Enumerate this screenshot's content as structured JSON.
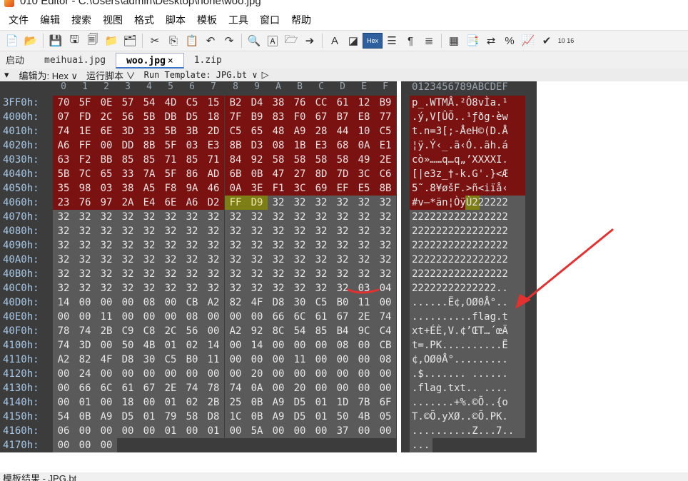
{
  "window": {
    "title": "010 Editor - C:\\Users\\admin\\Desktop\\none\\woo.jpg"
  },
  "menu": [
    "文件",
    "编辑",
    "搜索",
    "视图",
    "格式",
    "脚本",
    "模板",
    "工具",
    "窗口",
    "帮助"
  ],
  "toolbar": {
    "icons": [
      "new-file-icon",
      "open-folder-icon",
      "save-icon",
      "save-as-icon",
      "save-all-icon",
      "open-folder2-icon",
      "copy-files-icon",
      "cut-icon",
      "copy-icon",
      "paste-icon",
      "undo-icon",
      "redo-icon",
      "find-icon",
      "find-replace-icon",
      "find-in-files-icon",
      "goto-icon",
      "font-icon",
      "highlight-icon",
      "hex-mode-icon",
      "columns-icon",
      "paragraph-icon",
      "file-list-icon",
      "calculator-icon",
      "clipboard-icon",
      "swap-icon",
      "percent-icon",
      "chart-icon",
      "check-arrows-icon",
      "base-convert-icon"
    ],
    "hex_label": "Hex",
    "base_label": "10 16"
  },
  "tabs": [
    {
      "label": "启动"
    },
    {
      "label": "meihuai.jpg"
    },
    {
      "label": "woo.jpg",
      "close": "×"
    },
    {
      "label": "1.zip"
    }
  ],
  "options": {
    "collapse": "▾",
    "edit_as": "编辑为: Hex ∨",
    "run_script": "运行脚本 ∨",
    "run_template": "Run Template: JPG.bt ∨",
    "play": "▷"
  },
  "hex": {
    "columns": [
      "0",
      "1",
      "2",
      "3",
      "4",
      "5",
      "6",
      "7",
      "8",
      "9",
      "A",
      "B",
      "C",
      "D",
      "E",
      "F"
    ],
    "text_header": "0123456789ABCDEF",
    "rows": [
      {
        "addr": "3FF0h:",
        "bytes": [
          "70",
          "5F",
          "0E",
          "57",
          "54",
          "4D",
          "C5",
          "15",
          "B2",
          "D4",
          "38",
          "76",
          "CC",
          "61",
          "12",
          "B9"
        ],
        "text": "p_.WTMÅ.²Ô8vÌa.¹"
      },
      {
        "addr": "4000h:",
        "bytes": [
          "07",
          "FD",
          "2C",
          "56",
          "5B",
          "DB",
          "D5",
          "18",
          "7F",
          "B9",
          "83",
          "F0",
          "67",
          "B7",
          "E8",
          "77"
        ],
        "text": ".ý,V[ÛÕ..¹ƒðg·èw"
      },
      {
        "addr": "4010h:",
        "bytes": [
          "74",
          "1E",
          "6E",
          "3D",
          "33",
          "5B",
          "3B",
          "2D",
          "C5",
          "65",
          "48",
          "A9",
          "28",
          "44",
          "10",
          "C5"
        ],
        "text": "t.n=3[;-ÅeH©(D.Å"
      },
      {
        "addr": "4020h:",
        "bytes": [
          "A6",
          "FF",
          "00",
          "DD",
          "8B",
          "5F",
          "03",
          "E3",
          "8B",
          "D3",
          "08",
          "1B",
          "E3",
          "68",
          "0A",
          "E1"
        ],
        "text": "¦ÿ.Ý‹_.ã‹Ó..ãh.á"
      },
      {
        "addr": "4030h:",
        "bytes": [
          "63",
          "F2",
          "BB",
          "85",
          "85",
          "71",
          "85",
          "71",
          "84",
          "92",
          "58",
          "58",
          "58",
          "58",
          "49",
          "2E"
        ],
        "text": "cò»……q…q„’XXXXI."
      },
      {
        "addr": "4040h:",
        "bytes": [
          "5B",
          "7C",
          "65",
          "33",
          "7A",
          "5F",
          "86",
          "AD",
          "6B",
          "0B",
          "47",
          "27",
          "8D",
          "7D",
          "3C",
          "C6"
        ],
        "text": "[|e3z_†-k.G'.}<Æ"
      },
      {
        "addr": "4050h:",
        "bytes": [
          "35",
          "98",
          "03",
          "38",
          "A5",
          "F8",
          "9A",
          "46",
          "0A",
          "3E",
          "F1",
          "3C",
          "69",
          "EF",
          "E5",
          "8B"
        ],
        "text": "5˜.8¥øšF.>ñ<iïå‹"
      },
      {
        "addr": "4060h:",
        "bytes": [
          "23",
          "76",
          "97",
          "2A",
          "E4",
          "6E",
          "A6",
          "D2",
          "FF",
          "D9",
          "32",
          "32",
          "32",
          "32",
          "32",
          "32"
        ],
        "text": "#v—*än¦ÒÿÙ222222"
      },
      {
        "addr": "4070h:",
        "bytes": [
          "32",
          "32",
          "32",
          "32",
          "32",
          "32",
          "32",
          "32",
          "32",
          "32",
          "32",
          "32",
          "32",
          "32",
          "32",
          "32"
        ],
        "text": "2222222222222222"
      },
      {
        "addr": "4080h:",
        "bytes": [
          "32",
          "32",
          "32",
          "32",
          "32",
          "32",
          "32",
          "32",
          "32",
          "32",
          "32",
          "32",
          "32",
          "32",
          "32",
          "32"
        ],
        "text": "2222222222222222"
      },
      {
        "addr": "4090h:",
        "bytes": [
          "32",
          "32",
          "32",
          "32",
          "32",
          "32",
          "32",
          "32",
          "32",
          "32",
          "32",
          "32",
          "32",
          "32",
          "32",
          "32"
        ],
        "text": "2222222222222222"
      },
      {
        "addr": "40A0h:",
        "bytes": [
          "32",
          "32",
          "32",
          "32",
          "32",
          "32",
          "32",
          "32",
          "32",
          "32",
          "32",
          "32",
          "32",
          "32",
          "32",
          "32"
        ],
        "text": "2222222222222222"
      },
      {
        "addr": "40B0h:",
        "bytes": [
          "32",
          "32",
          "32",
          "32",
          "32",
          "32",
          "32",
          "32",
          "32",
          "32",
          "32",
          "32",
          "32",
          "32",
          "32",
          "32"
        ],
        "text": "2222222222222222"
      },
      {
        "addr": "40C0h:",
        "bytes": [
          "32",
          "32",
          "32",
          "32",
          "32",
          "32",
          "32",
          "32",
          "32",
          "32",
          "32",
          "32",
          "32",
          "32",
          "03",
          "04"
        ],
        "text": "22222222222222.."
      },
      {
        "addr": "40D0h:",
        "bytes": [
          "14",
          "00",
          "00",
          "00",
          "08",
          "00",
          "CB",
          "A2",
          "82",
          "4F",
          "D8",
          "30",
          "C5",
          "B0",
          "11",
          "00"
        ],
        "text": "......Ë¢‚OØ0Å°.."
      },
      {
        "addr": "40E0h:",
        "bytes": [
          "00",
          "00",
          "11",
          "00",
          "00",
          "00",
          "08",
          "00",
          "00",
          "00",
          "66",
          "6C",
          "61",
          "67",
          "2E",
          "74"
        ],
        "text": "..........flag.t"
      },
      {
        "addr": "40F0h:",
        "bytes": [
          "78",
          "74",
          "2B",
          "C9",
          "C8",
          "2C",
          "56",
          "00",
          "A2",
          "92",
          "8C",
          "54",
          "85",
          "B4",
          "9C",
          "C4"
        ],
        "text": "xt+ÉÈ,V.¢’ŒT…´œÄ"
      },
      {
        "addr": "4100h:",
        "bytes": [
          "74",
          "3D",
          "00",
          "50",
          "4B",
          "01",
          "02",
          "14",
          "00",
          "14",
          "00",
          "00",
          "00",
          "08",
          "00",
          "CB"
        ],
        "text": "t=.PK..........Ë"
      },
      {
        "addr": "4110h:",
        "bytes": [
          "A2",
          "82",
          "4F",
          "D8",
          "30",
          "C5",
          "B0",
          "11",
          "00",
          "00",
          "00",
          "11",
          "00",
          "00",
          "00",
          "08"
        ],
        "text": "¢‚OØ0Å°........."
      },
      {
        "addr": "4120h:",
        "bytes": [
          "00",
          "24",
          "00",
          "00",
          "00",
          "00",
          "00",
          "00",
          "00",
          "20",
          "00",
          "00",
          "00",
          "00",
          "00",
          "00"
        ],
        "text": ".$....... ......"
      },
      {
        "addr": "4130h:",
        "bytes": [
          "00",
          "66",
          "6C",
          "61",
          "67",
          "2E",
          "74",
          "78",
          "74",
          "0A",
          "00",
          "20",
          "00",
          "00",
          "00",
          "00"
        ],
        "text": ".flag.txt.. ...."
      },
      {
        "addr": "4140h:",
        "bytes": [
          "00",
          "01",
          "00",
          "18",
          "00",
          "01",
          "02",
          "2B",
          "25",
          "0B",
          "A9",
          "D5",
          "01",
          "1D",
          "7B",
          "6F"
        ],
        "text": ".......+%.©Õ..{o"
      },
      {
        "addr": "4150h:",
        "bytes": [
          "54",
          "0B",
          "A9",
          "D5",
          "01",
          "79",
          "58",
          "D8",
          "1C",
          "0B",
          "A9",
          "D5",
          "01",
          "50",
          "4B",
          "05"
        ],
        "text": "T.©Õ.yXØ..©Õ.PK."
      },
      {
        "addr": "4160h:",
        "bytes": [
          "06",
          "00",
          "00",
          "00",
          "00",
          "01",
          "00",
          "01",
          "00",
          "5A",
          "00",
          "00",
          "00",
          "37",
          "00",
          "00"
        ],
        "text": "..........Z...7.."
      },
      {
        "addr": "4170h:",
        "bytes": [
          "00",
          "00",
          "00"
        ],
        "text": "..."
      }
    ]
  },
  "status": {
    "text": "模板结果 - JPG.bt"
  },
  "colors": {
    "segment": "#7a1212",
    "eoi_marker": "#7e7e17",
    "padding": "#5a5a5a",
    "annotation": "#e53030"
  }
}
